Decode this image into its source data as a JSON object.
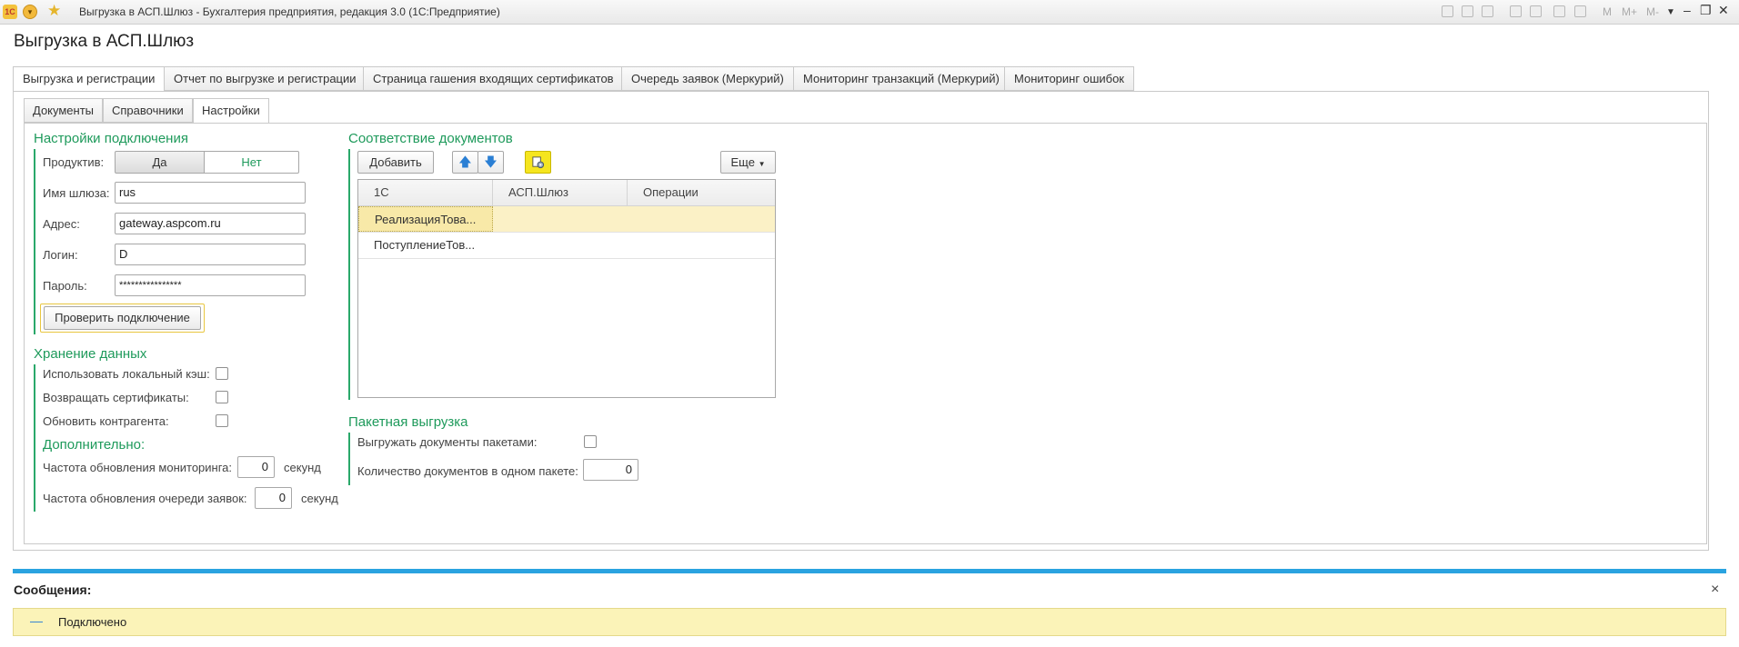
{
  "titlebar": {
    "logo": "1С",
    "title": "Выгрузка в АСП.Шлюз - Бухгалтерия предприятия, редакция 3.0  (1С:Предприятие)",
    "m_labels": [
      "M",
      "M+",
      "M-"
    ],
    "icons": [
      "app-menu-icon",
      "star-icon",
      "save-icon",
      "print-icon",
      "preview-icon",
      "export-icon",
      "copy-icon",
      "calculator-icon",
      "calendar-icon",
      "minimize-icon",
      "restore-icon",
      "close-icon"
    ]
  },
  "page": {
    "title": "Выгрузка в АСП.Шлюз"
  },
  "tabs": [
    {
      "label": "Выгрузка и регистрации",
      "active": true
    },
    {
      "label": "Отчет по выгрузке и регистрации"
    },
    {
      "label": "Страница гашения входящих сертификатов"
    },
    {
      "label": "Очередь заявок (Меркурий)"
    },
    {
      "label": "Мониторинг транзакций (Меркурий)"
    },
    {
      "label": "Мониторинг ошибок"
    }
  ],
  "subtabs": [
    {
      "label": "Документы"
    },
    {
      "label": "Справочники"
    },
    {
      "label": "Настройки",
      "active": true
    }
  ],
  "connection": {
    "title": "Настройки подключения",
    "productive_label": "Продуктив:",
    "productive_yes": "Да",
    "productive_no": "Нет",
    "gateway_label": "Имя шлюза:",
    "gateway_value": "rus",
    "address_label": "Адрес:",
    "address_value": "gateway.aspcom.ru",
    "login_label": "Логин:",
    "login_value": "D",
    "password_label": "Пароль:",
    "password_value": "****************",
    "check_button": "Проверить подключение"
  },
  "storage": {
    "title": "Хранение данных",
    "local_cache_label": "Использовать локальный кэш:",
    "return_certs_label": "Возвращать сертификаты:",
    "update_contractor_label": "Обновить контрагента:"
  },
  "additional": {
    "title": "Дополнительно:",
    "monitor_freq_label": "Частота обновления мониторинга:",
    "monitor_freq_value": "0",
    "monitor_freq_unit": "секунд",
    "queue_freq_label": "Частота обновления очереди заявок:",
    "queue_freq_value": "0",
    "queue_freq_unit": "секунд"
  },
  "docmap": {
    "title": "Соответствие документов",
    "add_button": "Добавить",
    "more_button": "Еще",
    "columns": [
      "1С",
      "АСП.Шлюз",
      "Операции"
    ],
    "rows": [
      [
        "РеализацияТова...",
        "",
        ""
      ],
      [
        "ПоступлениеТов...",
        "",
        ""
      ]
    ]
  },
  "batch": {
    "title": "Пакетная выгрузка",
    "batch_label": "Выгружать документы пакетами:",
    "count_label": "Количество документов в одном пакете:",
    "count_value": "0"
  },
  "messages": {
    "title": "Сообщения:",
    "close": "×",
    "dash": "—",
    "items": [
      "Подключено"
    ]
  },
  "colors": {
    "accent": "#1e9a5b",
    "message_bar": "#2aa3e0",
    "message_bg": "#fbf3b8",
    "selected_row": "#fbf1c6"
  }
}
